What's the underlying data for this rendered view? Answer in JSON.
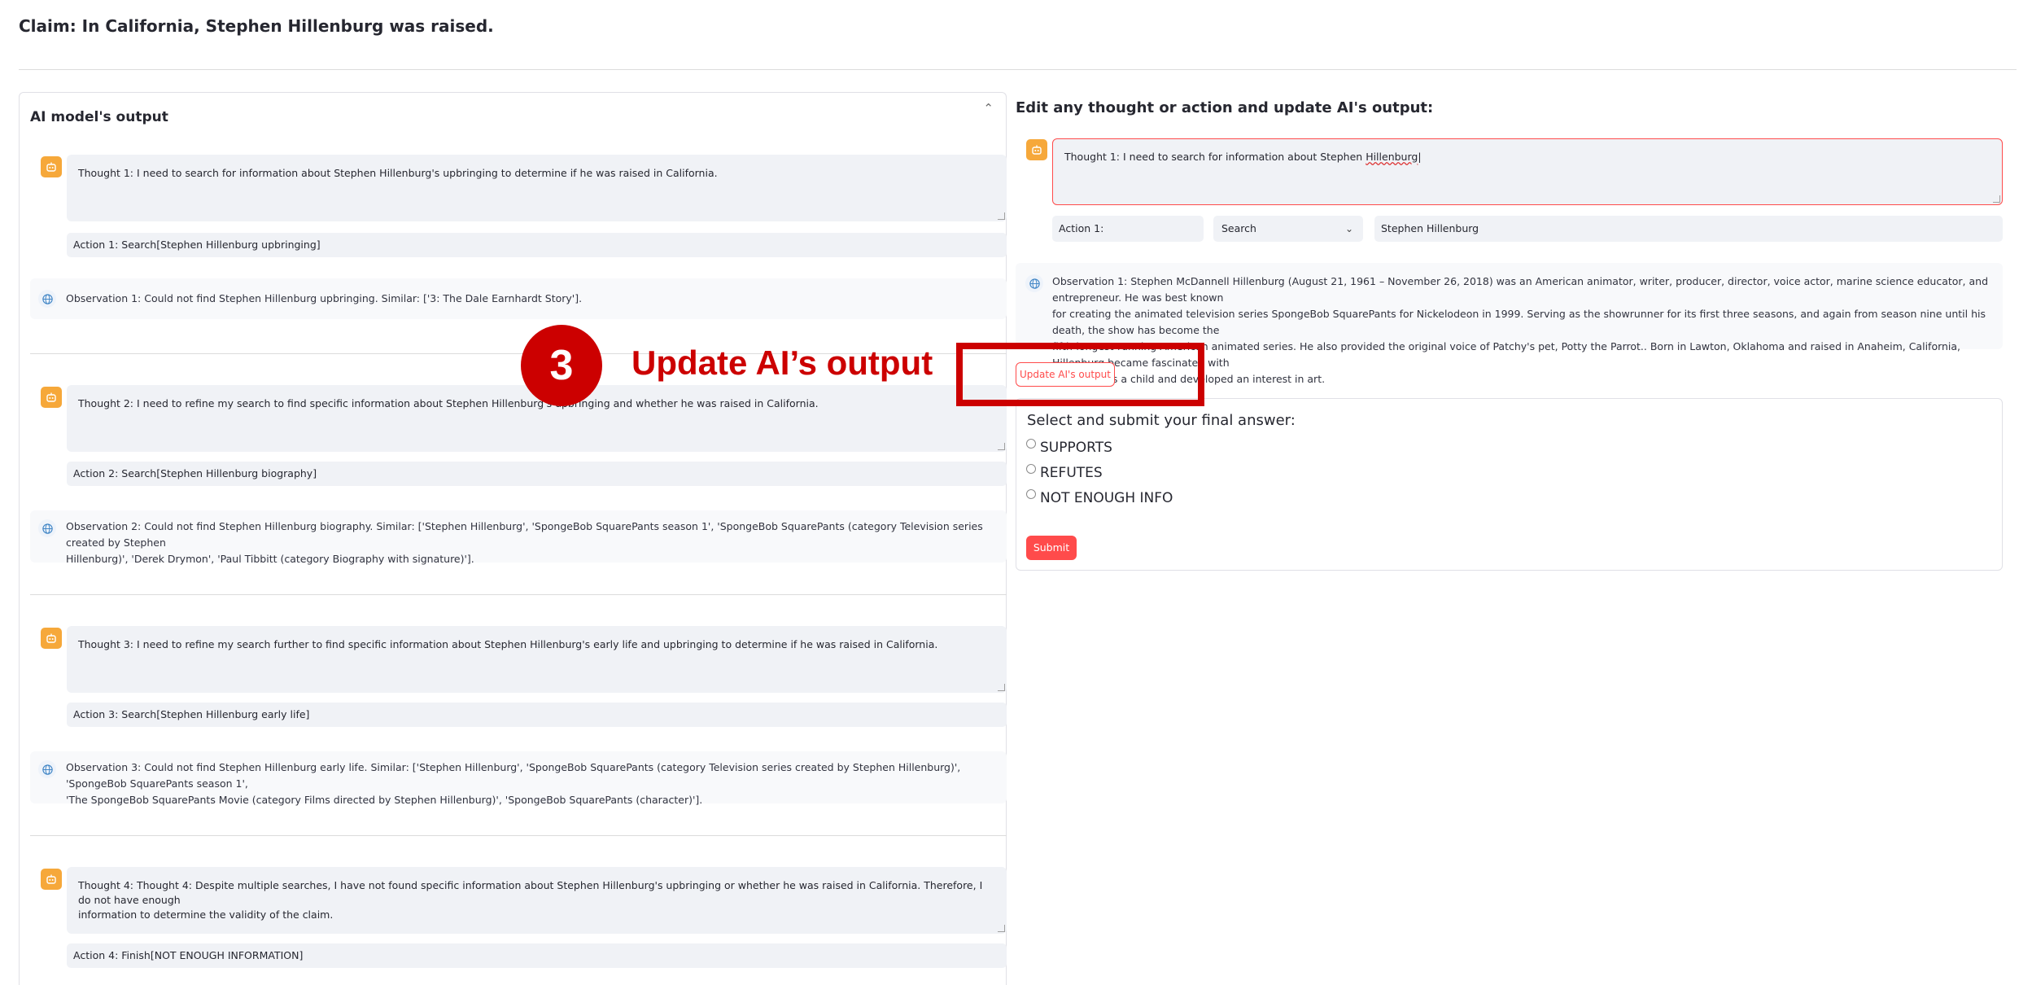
{
  "claim": "Claim: In California, Stephen Hillenburg was raised.",
  "left_panel": {
    "title": "AI model's output",
    "steps": [
      {
        "thought": "Thought 1: I need to search for information about Stephen Hillenburg's upbringing to determine if he was raised in California.",
        "action": "Action 1: Search[Stephen Hillenburg upbringing]",
        "observation": "Observation 1: Could not find Stephen Hillenburg upbringing. Similar: ['3: The Dale Earnhardt Story']."
      },
      {
        "thought": "Thought 2: I need to refine my search to find specific information about Stephen Hillenburg's upbringing and whether he was raised in California.",
        "action": "Action 2: Search[Stephen Hillenburg biography]",
        "observation_line1": "Observation 2: Could not find Stephen Hillenburg biography. Similar: ['Stephen Hillenburg', 'SpongeBob SquarePants season 1', 'SpongeBob SquarePants (category Television series created by Stephen",
        "observation_line2": "Hillenburg)', 'Derek Drymon', 'Paul Tibbitt (category Biography with signature)']."
      },
      {
        "thought": "Thought 3: I need to refine my search further to find specific information about Stephen Hillenburg's early life and upbringing to determine if he was raised in California.",
        "action": "Action 3: Search[Stephen Hillenburg early life]",
        "observation_line1": "Observation 3: Could not find Stephen Hillenburg early life. Similar: ['Stephen Hillenburg', 'SpongeBob SquarePants (category Television series created by Stephen Hillenburg)', 'SpongeBob SquarePants season 1',",
        "observation_line2": "'The SpongeBob SquarePants Movie (category Films directed by Stephen Hillenburg)', 'SpongeBob SquarePants (character)']."
      },
      {
        "thought_line1": "Thought 4: Thought 4: Despite multiple searches, I have not found specific information about Stephen Hillenburg's upbringing or whether he was raised in California. Therefore, I do not have enough",
        "thought_line2": "information to determine the validity of the claim.",
        "action": "Action 4: Finish[NOT ENOUGH INFORMATION]"
      }
    ]
  },
  "right_panel": {
    "title": "Edit any thought or action and update AI's output:",
    "thought_prefix": "Thought 1: I need to search for information about Stephen ",
    "thought_misspelled": "Hillenburg",
    "action_label": "Action 1:",
    "action_type": "Search",
    "action_arg": "Stephen Hillenburg",
    "observation_lines": [
      "Observation 1: Stephen McDannell Hillenburg (August 21, 1961 – November 26, 2018) was an American animator, writer, producer, director, voice actor, marine science educator, and entrepreneur. He was best known",
      "for creating the animated television series SpongeBob SquarePants for Nickelodeon in 1999. Serving as the showrunner for its first three seasons, and again from season nine until his death, the show has become the",
      "fifth-longest-running American animated series. He also provided the original voice of Patchy's pet, Potty the Parrot.. Born in Lawton, Oklahoma and raised in Anaheim, California, Hillenburg became fascinated with",
      "the ocean as a child and developed an interest in art."
    ],
    "update_button": "Update AI's output",
    "answer_title": "Select and submit your final answer:",
    "options": [
      "SUPPORTS",
      "REFUTES",
      "NOT ENOUGH INFO"
    ],
    "submit_button": "Submit"
  },
  "annotation": {
    "step_number": "3",
    "label": "Update AI’s output",
    "color": "#cc0000"
  },
  "colors": {
    "accent": "#ff4b4b",
    "bot_avatar": "#f6a83a",
    "input_bg": "#f0f2f6"
  }
}
